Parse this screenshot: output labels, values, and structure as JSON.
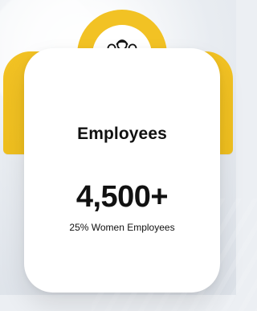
{
  "card": {
    "title": "Employees",
    "count": "4,500+",
    "subtitle": "25% Women Employees",
    "icon": "employees-icon"
  },
  "colors": {
    "accent": "#f2c224",
    "card": "#ffffff",
    "text": "#111111",
    "background": "#eceff3"
  }
}
